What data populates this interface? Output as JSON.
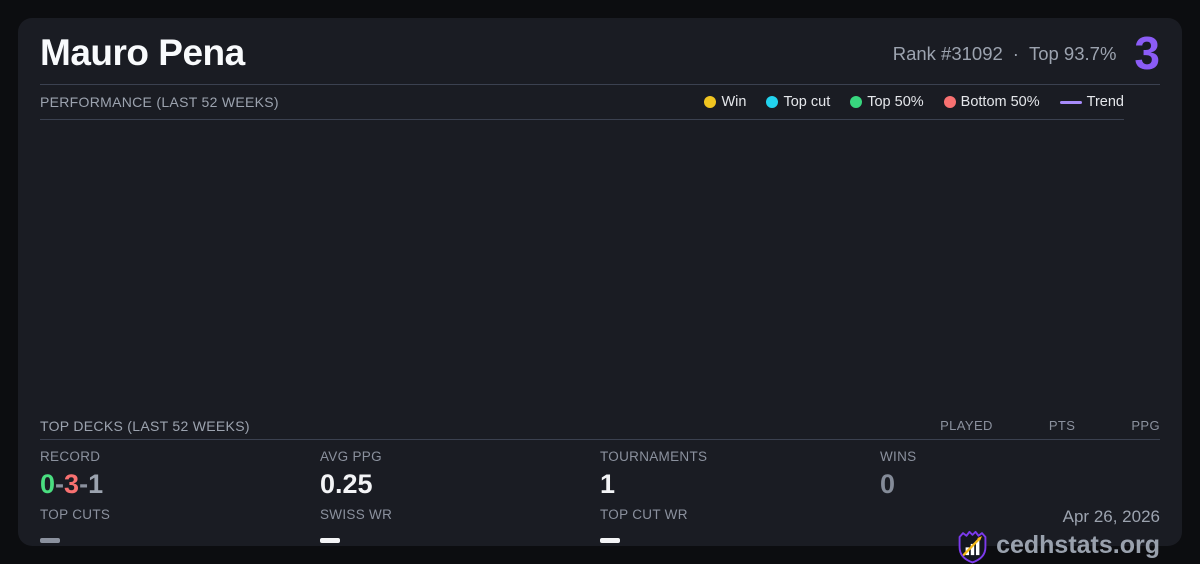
{
  "header": {
    "name": "Mauro Pena",
    "rank": "Rank #31092",
    "dot": "·",
    "top_percent": "Top 93.7%",
    "points": "3"
  },
  "performance": {
    "title": "PERFORMANCE (LAST 52 WEEKS)",
    "legend": [
      {
        "label": "Win",
        "color": "#f0c420"
      },
      {
        "label": "Top cut",
        "color": "#22d3ee"
      },
      {
        "label": "Top 50%",
        "color": "#38d67e"
      },
      {
        "label": "Bottom 50%",
        "color": "#f87171"
      },
      {
        "label": "Trend",
        "color": "#a78bfa"
      }
    ]
  },
  "chart_data": {
    "type": "scatter",
    "title": "PERFORMANCE (LAST 52 WEEKS)",
    "x_range_weeks": 52,
    "legend": [
      "Win",
      "Top cut",
      "Top 50%",
      "Bottom 50%",
      "Trend"
    ],
    "series": [
      {
        "name": "Win",
        "points": []
      },
      {
        "name": "Top cut",
        "points": []
      },
      {
        "name": "Top 50%",
        "points": []
      },
      {
        "name": "Bottom 50%",
        "points": []
      },
      {
        "name": "Trend",
        "points": []
      }
    ],
    "note": "chart plot area is empty in the screenshot"
  },
  "top_decks": {
    "title": "TOP DECKS (LAST 52 WEEKS)",
    "columns": [
      "PLAYED",
      "PTS",
      "PPG"
    ],
    "rows": []
  },
  "stats": {
    "record": {
      "label": "RECORD",
      "wins": "0",
      "sep": "-",
      "losses": "3",
      "draws": "1"
    },
    "avg_ppg": {
      "label": "AVG PPG",
      "value": "0.25"
    },
    "tournaments": {
      "label": "TOURNAMENTS",
      "value": "1"
    },
    "wins": {
      "label": "WINS",
      "value": "0"
    },
    "top_cuts": {
      "label": "TOP CUTS",
      "placeholder": "dash"
    },
    "swiss_wr": {
      "label": "SWISS WR",
      "placeholder": "dash"
    },
    "top_cut_wr": {
      "label": "TOP CUT WR",
      "placeholder": "dash"
    }
  },
  "footer": {
    "date": "Apr 26, 2026",
    "brand": "cedhstats.org"
  },
  "colors": {
    "accent_points": "#8b5cf6",
    "win": "#f0c420",
    "top_cut": "#22d3ee",
    "top_50": "#38d67e",
    "bottom_50": "#f87171",
    "trend": "#a78bfa",
    "record_win": "#4ade80",
    "record_loss": "#f87171",
    "record_draw": "#9ca3af",
    "card_bg": "#1a1c23",
    "page_bg": "#0c0d10"
  }
}
